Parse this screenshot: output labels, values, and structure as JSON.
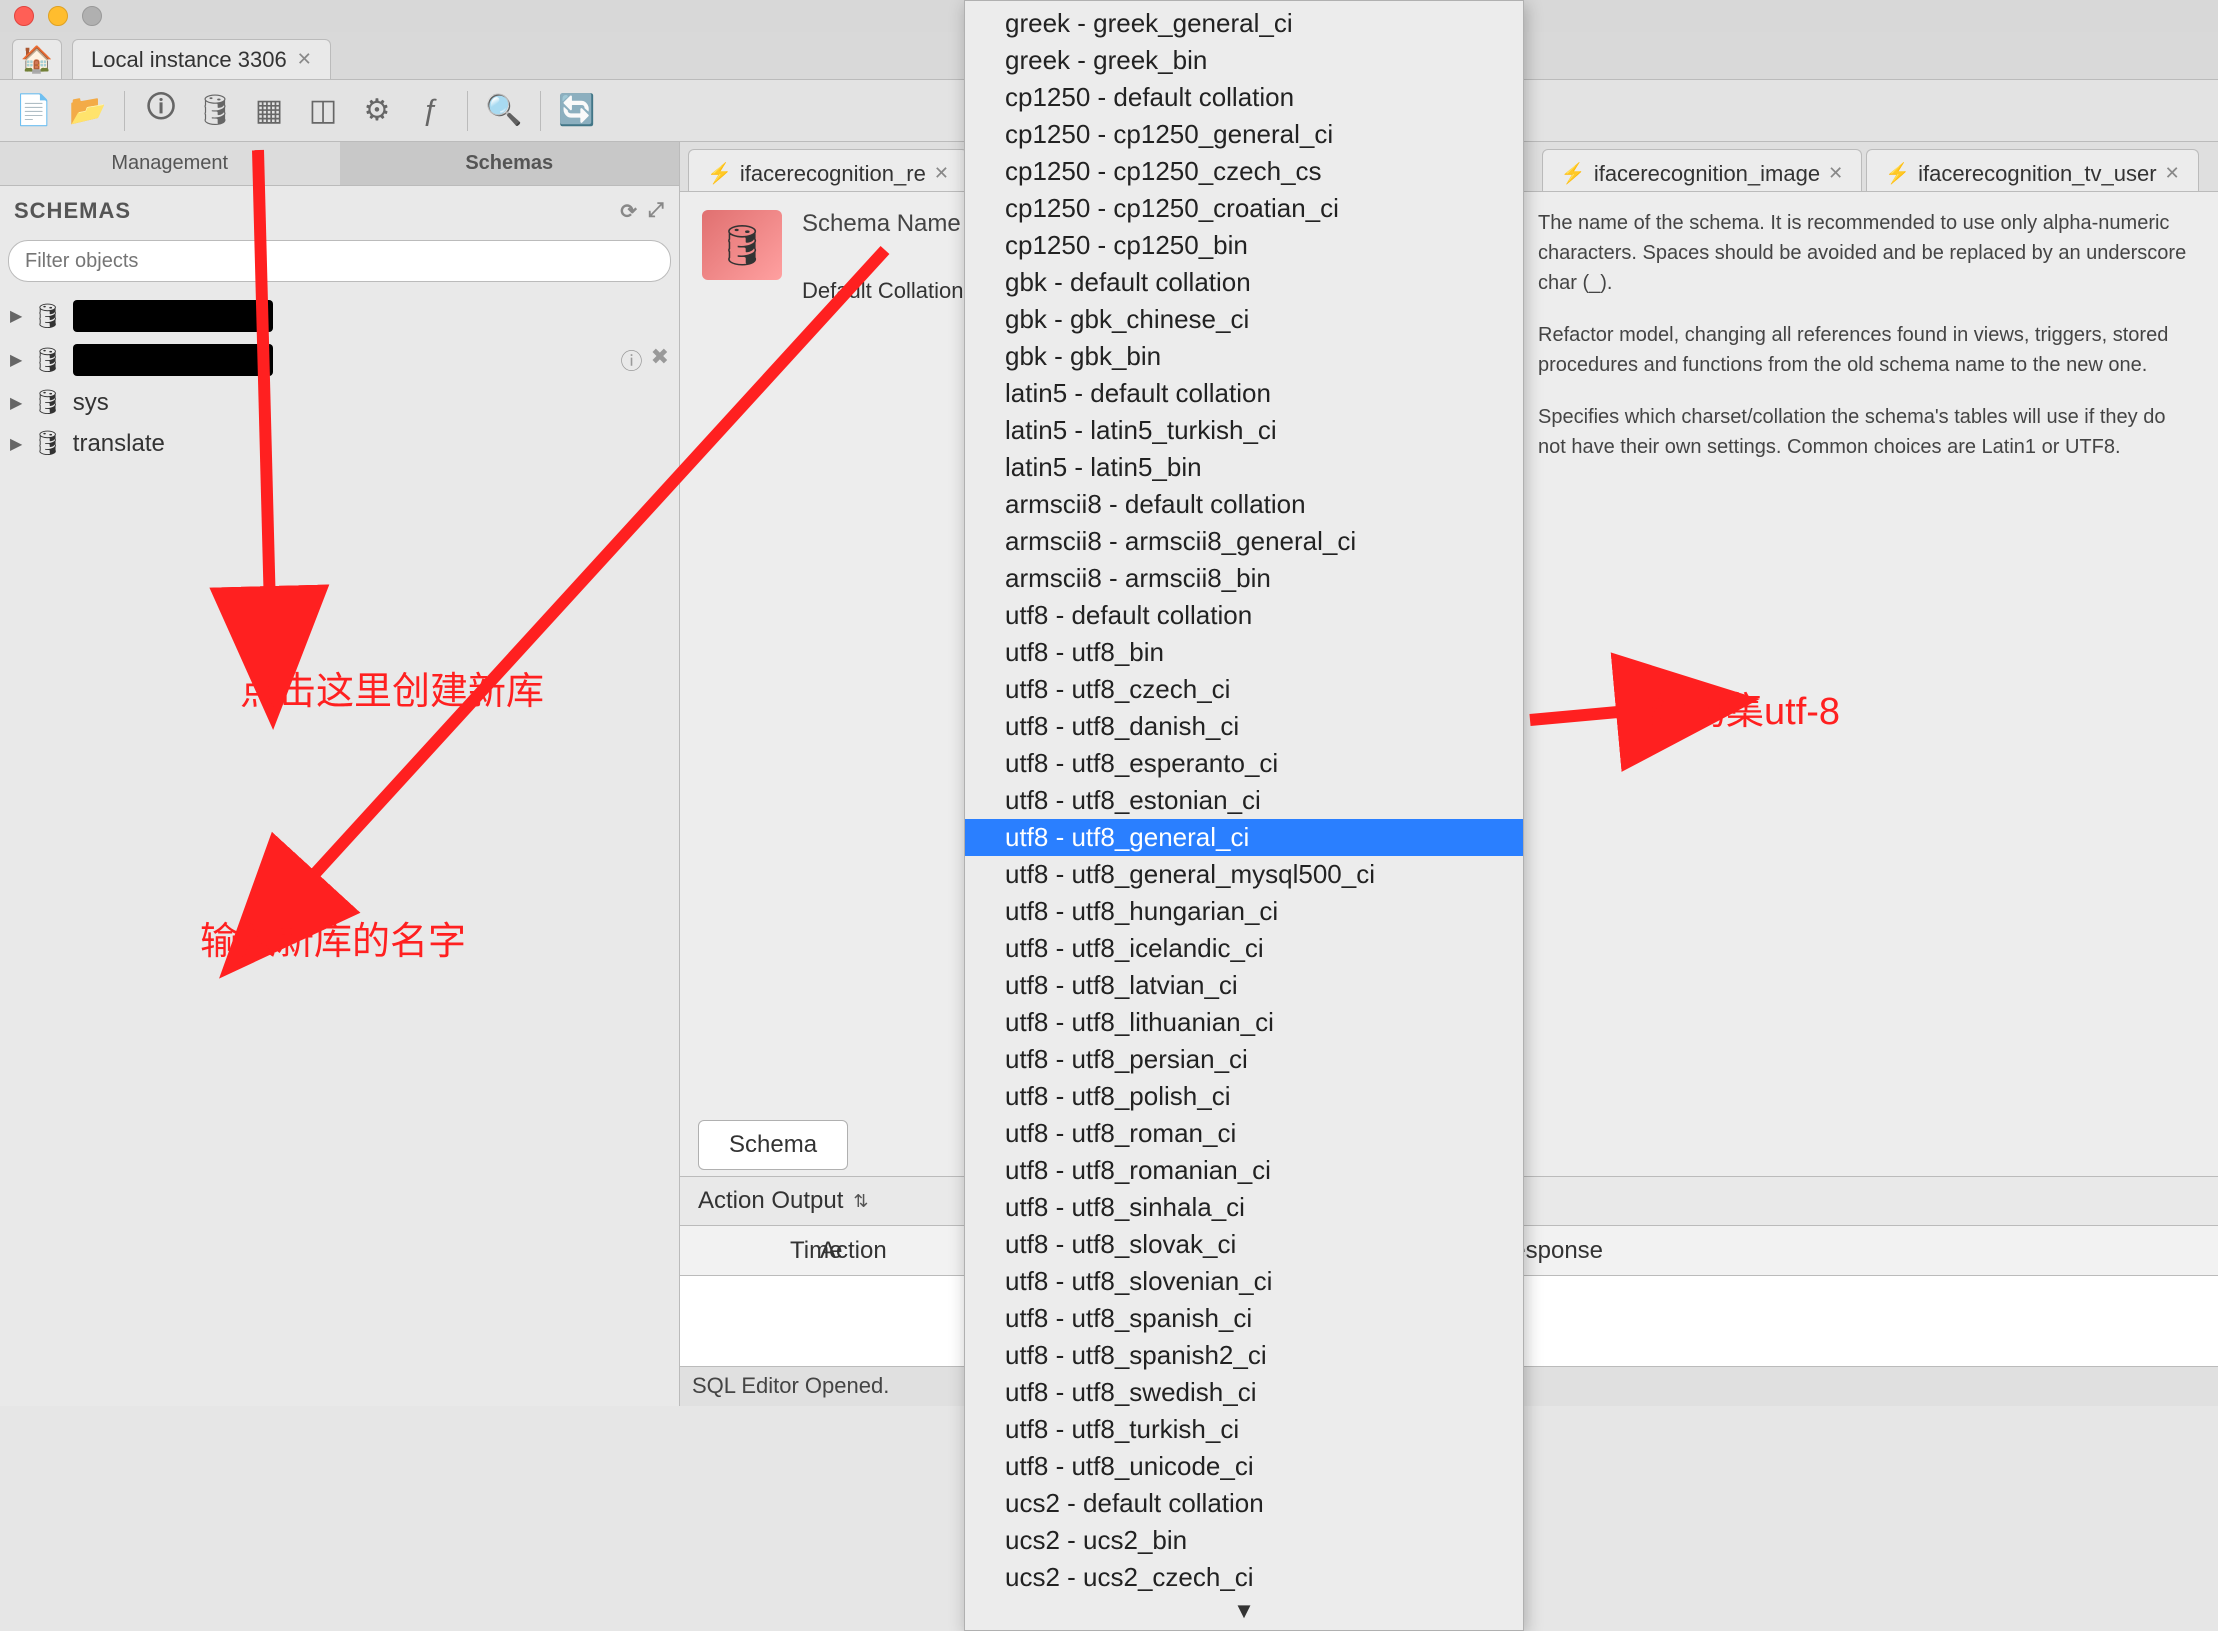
{
  "window": {
    "conn_tab": "Local instance 3306"
  },
  "sidebar": {
    "toggle": {
      "management": "Management",
      "schemas": "Schemas"
    },
    "header": "SCHEMAS",
    "filter_placeholder": "Filter objects",
    "items": [
      {
        "label": "",
        "redacted": true
      },
      {
        "label": "",
        "redacted": true
      },
      {
        "label": "sys",
        "redacted": false
      },
      {
        "label": "translate",
        "redacted": false
      }
    ]
  },
  "doc_tabs": [
    {
      "label": "ifacerecognition_re"
    },
    {
      "label": "ifacerecognition_image"
    },
    {
      "label": "ifacerecognition_tv_user"
    }
  ],
  "form": {
    "schema_name_label": "Schema Name",
    "collation_label": "Default Collation:"
  },
  "help": {
    "p1": "The name of the schema. It is recommended to use only alpha-numeric characters. Spaces should be avoided and be replaced by an underscore char (_).",
    "p2": "Refactor model, changing all references found in views, triggers, stored procedures and functions from the old schema name to the new one.",
    "p3": "Specifies which charset/collation the schema's tables will use if they do not have their own settings. Common choices are Latin1 or UTF8."
  },
  "schema_tab": "Schema",
  "output": {
    "combo": "Action Output",
    "col_time": "Time",
    "col_action": "Action",
    "col_response": "Response"
  },
  "status": "SQL Editor Opened.",
  "dropdown": {
    "items": [
      "greek - greek_general_ci",
      "greek - greek_bin",
      "cp1250 - default collation",
      "cp1250 - cp1250_general_ci",
      "cp1250 - cp1250_czech_cs",
      "cp1250 - cp1250_croatian_ci",
      "cp1250 - cp1250_bin",
      "gbk - default collation",
      "gbk - gbk_chinese_ci",
      "gbk - gbk_bin",
      "latin5 - default collation",
      "latin5 - latin5_turkish_ci",
      "latin5 - latin5_bin",
      "armscii8 - default collation",
      "armscii8 - armscii8_general_ci",
      "armscii8 - armscii8_bin",
      "utf8 - default collation",
      "utf8 - utf8_bin",
      "utf8 - utf8_czech_ci",
      "utf8 - utf8_danish_ci",
      "utf8 - utf8_esperanto_ci",
      "utf8 - utf8_estonian_ci",
      "utf8 - utf8_general_ci",
      "utf8 - utf8_general_mysql500_ci",
      "utf8 - utf8_hungarian_ci",
      "utf8 - utf8_icelandic_ci",
      "utf8 - utf8_latvian_ci",
      "utf8 - utf8_lithuanian_ci",
      "utf8 - utf8_persian_ci",
      "utf8 - utf8_polish_ci",
      "utf8 - utf8_roman_ci",
      "utf8 - utf8_romanian_ci",
      "utf8 - utf8_sinhala_ci",
      "utf8 - utf8_slovak_ci",
      "utf8 - utf8_slovenian_ci",
      "utf8 - utf8_spanish_ci",
      "utf8 - utf8_spanish2_ci",
      "utf8 - utf8_swedish_ci",
      "utf8 - utf8_turkish_ci",
      "utf8 - utf8_unicode_ci",
      "ucs2 - default collation",
      "ucs2 - ucs2_bin",
      "ucs2 - ucs2_czech_ci"
    ],
    "selected_index": 22
  },
  "annotations": {
    "a1": "点击这里创建新库",
    "a2": "输入新库的名字",
    "a3": "编码集utf-8"
  }
}
